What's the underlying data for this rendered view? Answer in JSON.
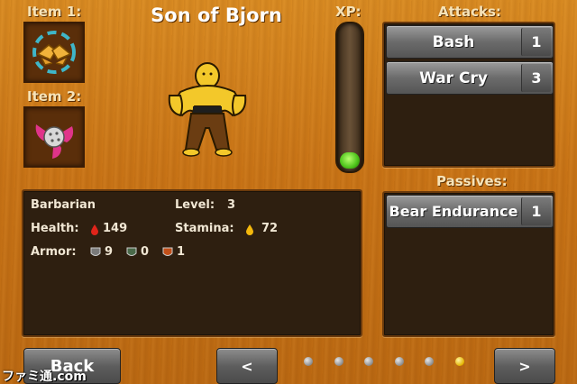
{
  "header": {
    "character_name": "Son of Bjorn",
    "item1_label": "Item 1:",
    "item2_label": "Item 2:",
    "xp_label": "XP:",
    "attacks_label": "Attacks:",
    "passives_label": "Passives:"
  },
  "xp": {
    "fill_fraction": 0.1
  },
  "attacks": [
    {
      "name": "Bash",
      "count": "1"
    },
    {
      "name": "War Cry",
      "count": "3"
    }
  ],
  "passives": [
    {
      "name": "Bear Endurance",
      "count": "1"
    }
  ],
  "stats": {
    "class": "Barbarian",
    "level_label": "Level:",
    "level": "3",
    "health_label": "Health:",
    "health": "149",
    "stamina_label": "Stamina:",
    "stamina": "72",
    "armor_label": "Armor:",
    "armor_values": [
      "9",
      "0",
      "1"
    ]
  },
  "nav": {
    "back_label": "Back",
    "prev_label": "<",
    "next_label": ">",
    "page_count": 6,
    "active_page": 6
  },
  "watermark": "ファミ通.com",
  "colors": {
    "xp_green": "#4cc21a",
    "active_dot": "#e2b300"
  }
}
